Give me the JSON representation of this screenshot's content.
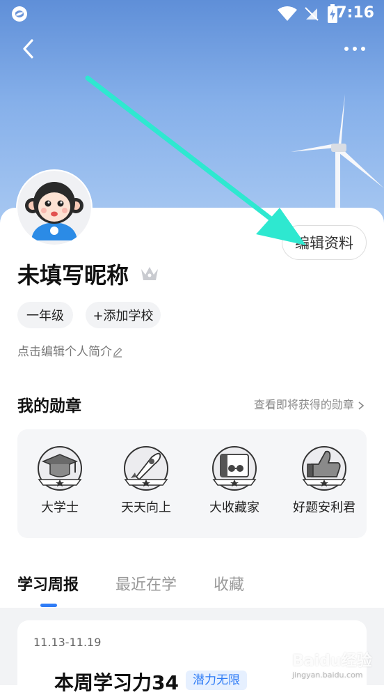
{
  "status_bar": {
    "time": "7:16"
  },
  "header": {
    "back_icon": "chevron-left-icon",
    "more_icon": "more-horizontal-icon"
  },
  "profile": {
    "edit_label": "编辑资料",
    "nickname": "未填写昵称",
    "tags": [
      "一年级",
      "+添加学校"
    ],
    "bio_prompt": "点击编辑个人简介"
  },
  "badges": {
    "title": "我的勋章",
    "link": "查看即将获得的勋章",
    "items": [
      {
        "label": "大学士",
        "icon": "graduation-cap-badge-icon"
      },
      {
        "label": "天天向上",
        "icon": "rocket-badge-icon"
      },
      {
        "label": "大收藏家",
        "icon": "book-collector-badge-icon"
      },
      {
        "label": "好题安利君",
        "icon": "thumbs-up-badge-icon"
      }
    ]
  },
  "tabs": [
    {
      "label": "学习周报",
      "active": true
    },
    {
      "label": "最近在学",
      "active": false
    },
    {
      "label": "收藏",
      "active": false
    }
  ],
  "report": {
    "date_range": "11.13-11.19",
    "title": "本周学习力34",
    "tag": "潜力无限"
  },
  "watermark": {
    "text": "Baidu经验",
    "sub": "jingyan.baidu.com"
  },
  "colors": {
    "accent": "#2f7cf6",
    "sky": "#7fa9e6",
    "arrow": "#2ee8d0"
  }
}
